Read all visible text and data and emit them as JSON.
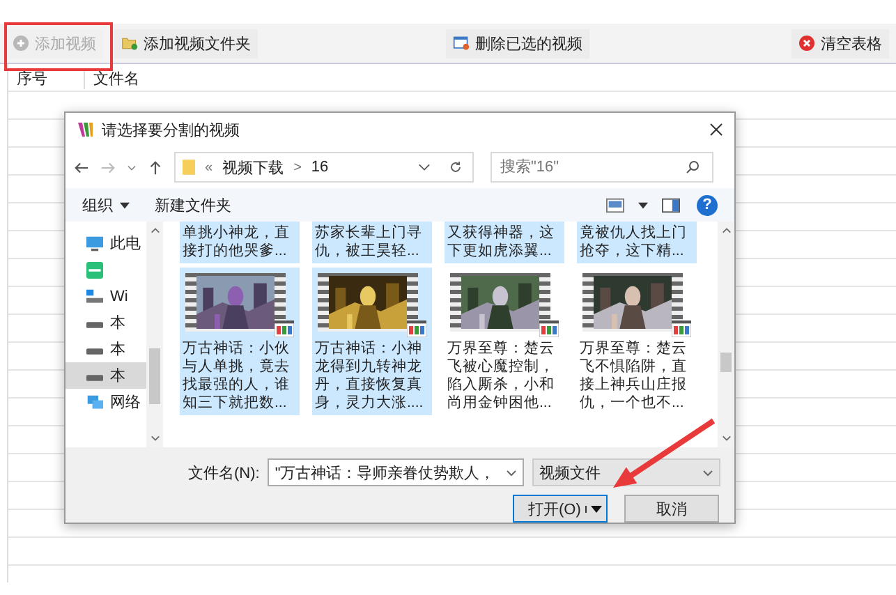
{
  "toolbar": [
    {
      "label": "添加视频",
      "disabled": true
    },
    {
      "label": "添加视频文件夹",
      "disabled": false
    },
    {
      "label": "删除已选的视频",
      "disabled": false
    },
    {
      "label": "清空表格",
      "disabled": false
    }
  ],
  "table": {
    "columns": [
      "序号",
      "文件名"
    ]
  },
  "dialog": {
    "title": "请选择要分割的视频",
    "address": {
      "prefix": "«",
      "crumbs": [
        "视频下载",
        "16"
      ],
      "separator": ">"
    },
    "search": {
      "placeholder": "搜索\"16\""
    },
    "commands": {
      "organize": "组织",
      "new_folder": "新建文件夹",
      "help": "?"
    },
    "sidebar": [
      {
        "label": "此电",
        "kind": "computer",
        "selected": false
      },
      {
        "kind": "app",
        "selected": false
      },
      {
        "label": "Wi",
        "kind": "system",
        "selected": false
      },
      {
        "label": "本",
        "kind": "drive",
        "selected": false
      },
      {
        "label": "本",
        "kind": "drive",
        "selected": false
      },
      {
        "label": "本",
        "kind": "drive",
        "selected": true
      },
      {
        "label": "网络",
        "kind": "network",
        "selected": false
      }
    ],
    "tiles": [
      {
        "kind": "partial",
        "text": "单挑小神龙，直接打的他哭爹...",
        "selected": true
      },
      {
        "kind": "partial",
        "text": "苏家长辈上门寻仇，被王昊轻...",
        "selected": true
      },
      {
        "kind": "partial",
        "text": "又获得神器，这下更如虎添翼...",
        "selected": true
      },
      {
        "kind": "partial",
        "text": "竟被仇人找上门抢夺，这下精...",
        "selected": true
      },
      {
        "kind": "video",
        "text": "万古神话：小伙与人单挑，竟去找最强的人，谁知三下就把数...",
        "selected": true
      },
      {
        "kind": "video",
        "text": "万古神话：小神龙得到九转神龙丹，直接恢复真身，灵力大涨....",
        "selected": true
      },
      {
        "kind": "video",
        "text": "万界至尊：楚云飞被心魔控制，陷入厮杀，小和尚用金钟困他...",
        "selected": false
      },
      {
        "kind": "video",
        "text": "万界至尊：楚云飞不惧陷阱，直接上神兵山庄报仇，一个也不...",
        "selected": false
      }
    ],
    "filename": {
      "label": "文件名(N):",
      "value": "\"万古神话：导师亲眷仗势欺人，"
    },
    "filter": {
      "value": "视频文件"
    },
    "buttons": [
      {
        "label": "打开(O)",
        "kind": "split",
        "default": true
      },
      {
        "label": "取消",
        "kind": "plain",
        "default": false
      }
    ]
  }
}
